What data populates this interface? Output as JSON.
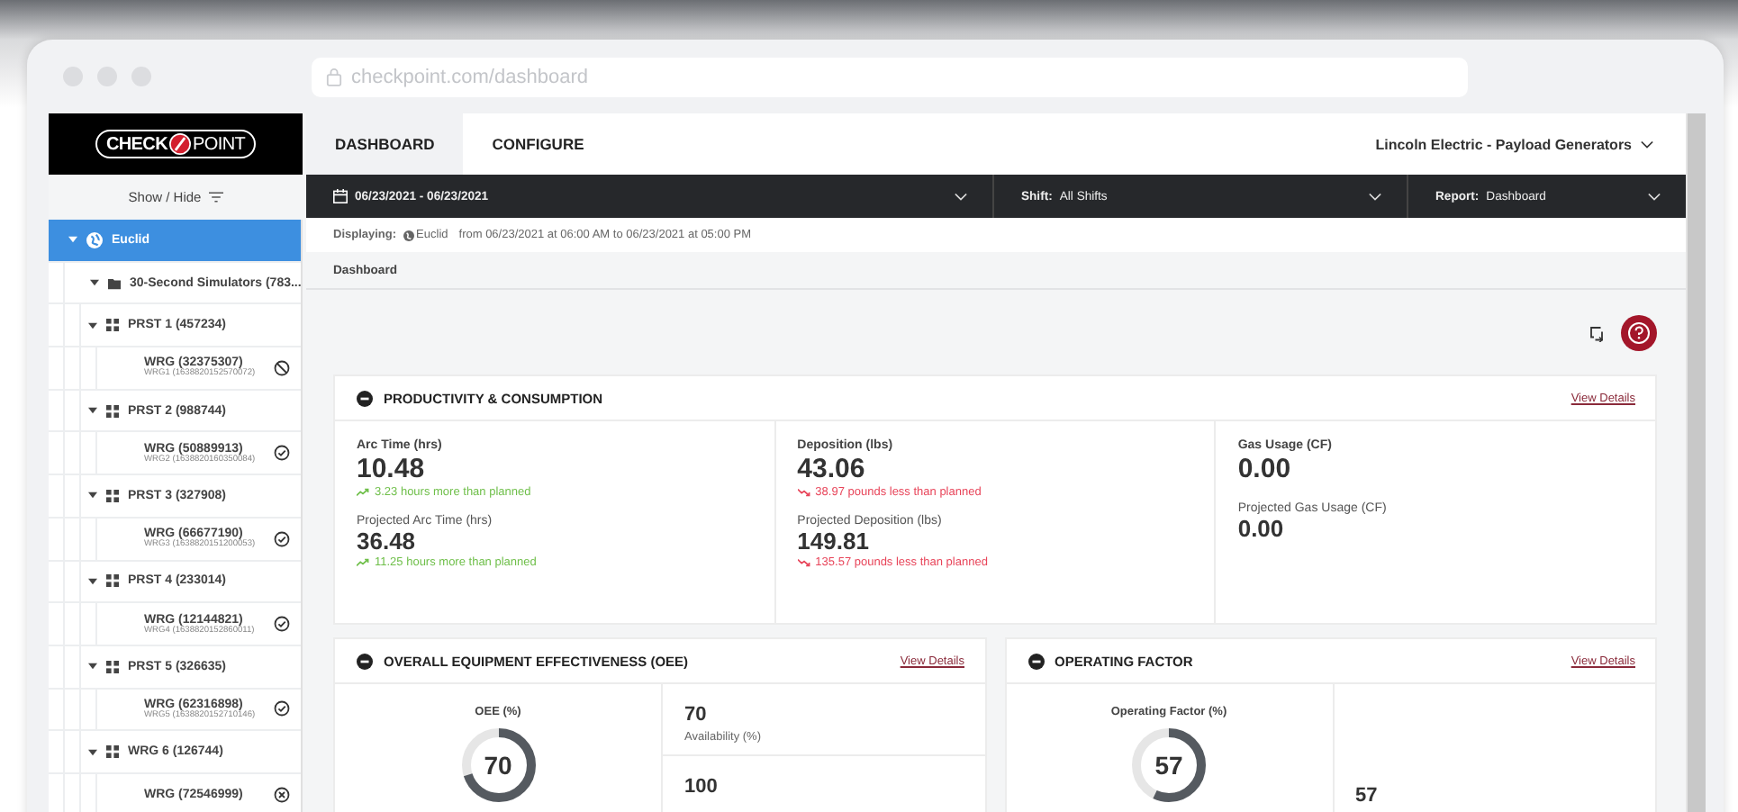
{
  "browser": {
    "url": "checkpoint.com/dashboard"
  },
  "logo": {
    "left": "CHECK",
    "right": "POINT"
  },
  "sidebar": {
    "toggle_label": "Show / Hide",
    "tree": [
      {
        "kind": "site",
        "label": "Euclid",
        "selected": true,
        "expanded": true,
        "children": [
          {
            "kind": "folder",
            "label": "30-Second Simulators (783...",
            "selected": false,
            "expanded": true,
            "children": [
              {
                "kind": "group",
                "label": "PRST 1 (457234)",
                "selected": false,
                "expanded": true,
                "children": [
                  {
                    "label": "WRG (32375307)",
                    "sublabel": "WRG1 (1638820152570072)",
                    "kind": "blocked",
                    "selected": false
                  }
                ]
              },
              {
                "kind": "group",
                "label": "PRST 2 (988744)",
                "selected": false,
                "expanded": true,
                "children": [
                  {
                    "label": "WRG (50889913)",
                    "sublabel": "WRG2 (1638820160350084)",
                    "kind": "ok",
                    "selected": false
                  }
                ]
              },
              {
                "kind": "group",
                "label": "PRST 3 (327908)",
                "selected": false,
                "expanded": true,
                "children": [
                  {
                    "label": "WRG (66677190)",
                    "sublabel": "WRG3 (1638820151200053)",
                    "kind": "ok",
                    "selected": false
                  }
                ]
              },
              {
                "kind": "group",
                "label": "PRST 4 (233014)",
                "selected": false,
                "expanded": true,
                "children": [
                  {
                    "label": "WRG (12144821)",
                    "sublabel": "WRG4 (1638820152860011)",
                    "kind": "ok",
                    "selected": false
                  }
                ]
              },
              {
                "kind": "group",
                "label": "PRST 5 (326635)",
                "selected": false,
                "expanded": true,
                "children": [
                  {
                    "label": "WRG (62316898)",
                    "sublabel": "WRG5 (1638820152710146)",
                    "kind": "ok",
                    "selected": false
                  }
                ]
              },
              {
                "kind": "group",
                "label": "WRG 6 (126744)",
                "selected": false,
                "expanded": true,
                "children": [
                  {
                    "label": "WRG (72546999)",
                    "kind": "error",
                    "selected": false
                  }
                ]
              }
            ]
          }
        ]
      }
    ]
  },
  "tabs": [
    {
      "label": "DASHBOARD",
      "selected": true
    },
    {
      "label": "CONFIGURE",
      "selected": false
    }
  ],
  "organization": "Lincoln Electric - Payload Generators",
  "filters": [
    {
      "kind": "date",
      "value": "06/23/2021 - 06/23/2021"
    },
    {
      "kind": "select",
      "label": "Shift:",
      "value": "All Shifts"
    },
    {
      "kind": "select",
      "label": "Report:",
      "value": "Dashboard"
    }
  ],
  "displaying": {
    "label": "Displaying:",
    "site": "Euclid",
    "range": "from 06/23/2021 at 06:00 AM to 06/23/2021 at 05:00 PM"
  },
  "breadcrumb": "Dashboard",
  "productivity": {
    "title": "PRODUCTIVITY & CONSUMPTION",
    "link": "View Details",
    "columns": [
      [
        {
          "label": "Arc Time (hrs)",
          "value": "10.48",
          "delta": "3.23 hours more than planned",
          "kind": "up"
        },
        {
          "label": "Projected Arc Time (hrs)",
          "value": "36.48",
          "delta": "11.25 hours more than planned",
          "kind": "up"
        }
      ],
      [
        {
          "label": "Deposition (lbs)",
          "value": "43.06",
          "delta": "38.97 pounds less than planned",
          "kind": "down"
        },
        {
          "label": "Projected Deposition (lbs)",
          "value": "149.81",
          "delta": "135.57 pounds less than planned",
          "kind": "down"
        }
      ],
      [
        {
          "label": "Gas Usage (CF)",
          "value": "0.00"
        },
        {
          "label": "Projected Gas Usage (CF)",
          "value": "0.00"
        }
      ]
    ]
  },
  "panels": [
    {
      "title": "OVERALL EQUIPMENT EFFECTIVENESS (OEE)",
      "link": "View Details",
      "gauge": {
        "label": "OEE (%)",
        "value": "70",
        "level": 0.7
      },
      "stats": [
        {
          "value": "70",
          "label": "Availability (%)"
        },
        {
          "value": "100"
        }
      ]
    },
    {
      "title": "OPERATING FACTOR",
      "link": "View Details",
      "gauge": {
        "label": "Operating Factor (%)",
        "value": "57",
        "level": 0.57
      },
      "stats": [
        {
          "value": "57"
        }
      ]
    }
  ]
}
